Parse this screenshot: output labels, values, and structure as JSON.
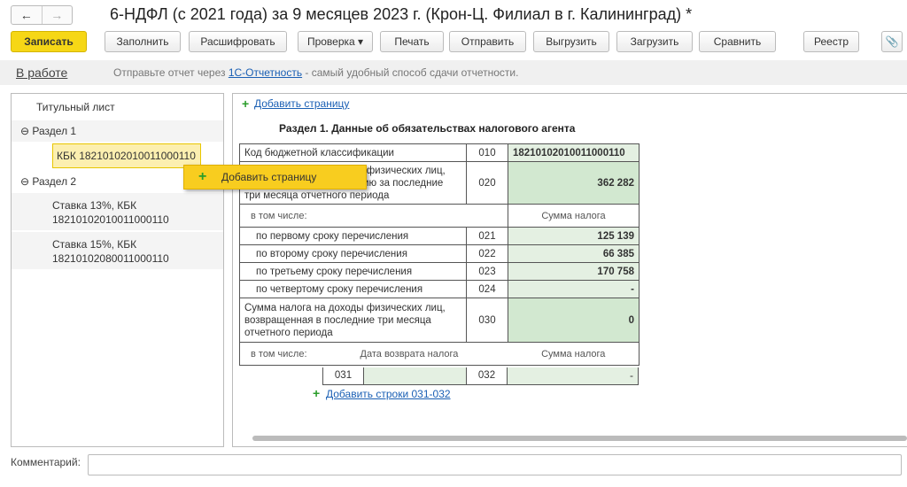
{
  "window": {
    "title": "6-НДФЛ (с 2021 года) за 9 месяцев 2023 г. (Крон-Ц. Филиал в г. Калининград) *",
    "back": "←",
    "forward": "→"
  },
  "toolbar": {
    "save": "Записать",
    "fill": "Заполнить",
    "decode": "Расшифровать",
    "check": "Проверка ▾",
    "print": "Печать",
    "send": "Отправить",
    "export": "Выгрузить",
    "import": "Загрузить",
    "compare": "Сравнить",
    "registry": "Реестр",
    "attach": "📎"
  },
  "status": {
    "state": "В работе",
    "msg_before": "Отправьте отчет через ",
    "link": "1С-Отчетность",
    "msg_after": " - самый удобный способ сдачи отчетности."
  },
  "tree": {
    "title_page": "Титульный лист",
    "section1": "Раздел 1",
    "kbk1": "КБК 18210102010011000110",
    "section2": "Раздел 2",
    "rate13": "Ставка 13%, КБК",
    "rate13_kbk": "18210102010011000110",
    "rate15": "Ставка 15%, КБК",
    "rate15_kbk": "18210102080011000110",
    "collapse": "⊖"
  },
  "popup": {
    "label": "Добавить страницу",
    "plus": "+"
  },
  "form": {
    "add_page": "Добавить страницу",
    "heading": "Раздел 1. Данные об обязательствах налогового агента",
    "r010": {
      "label": "Код бюджетной классификации",
      "code": "010",
      "value": "18210102010011000110"
    },
    "r020": {
      "label": "Сумма налога на доходы физических лиц, подлежащая перечислению за последние три месяца отчетного периода",
      "code": "020",
      "value": "362 282"
    },
    "incl": "в том числе:",
    "tax_sum": "Сумма налога",
    "r021": {
      "label": "по первому сроку перечисления",
      "code": "021",
      "value": "125 139"
    },
    "r022": {
      "label": "по второму сроку перечисления",
      "code": "022",
      "value": "66 385"
    },
    "r023": {
      "label": "по третьему сроку перечисления",
      "code": "023",
      "value": "170 758"
    },
    "r024": {
      "label": "по четвертому сроку перечисления",
      "code": "024",
      "value": "-"
    },
    "r030": {
      "label": "Сумма налога на доходы физических лиц, возвращенная в последние три месяца отчетного периода",
      "code": "030",
      "value": "0"
    },
    "return_date": "Дата возврата налога",
    "c031": "031",
    "c032": "032",
    "v032": "-",
    "add_rows": "Добавить строки 031-032"
  },
  "comment": {
    "label": "Комментарий:",
    "value": ""
  }
}
